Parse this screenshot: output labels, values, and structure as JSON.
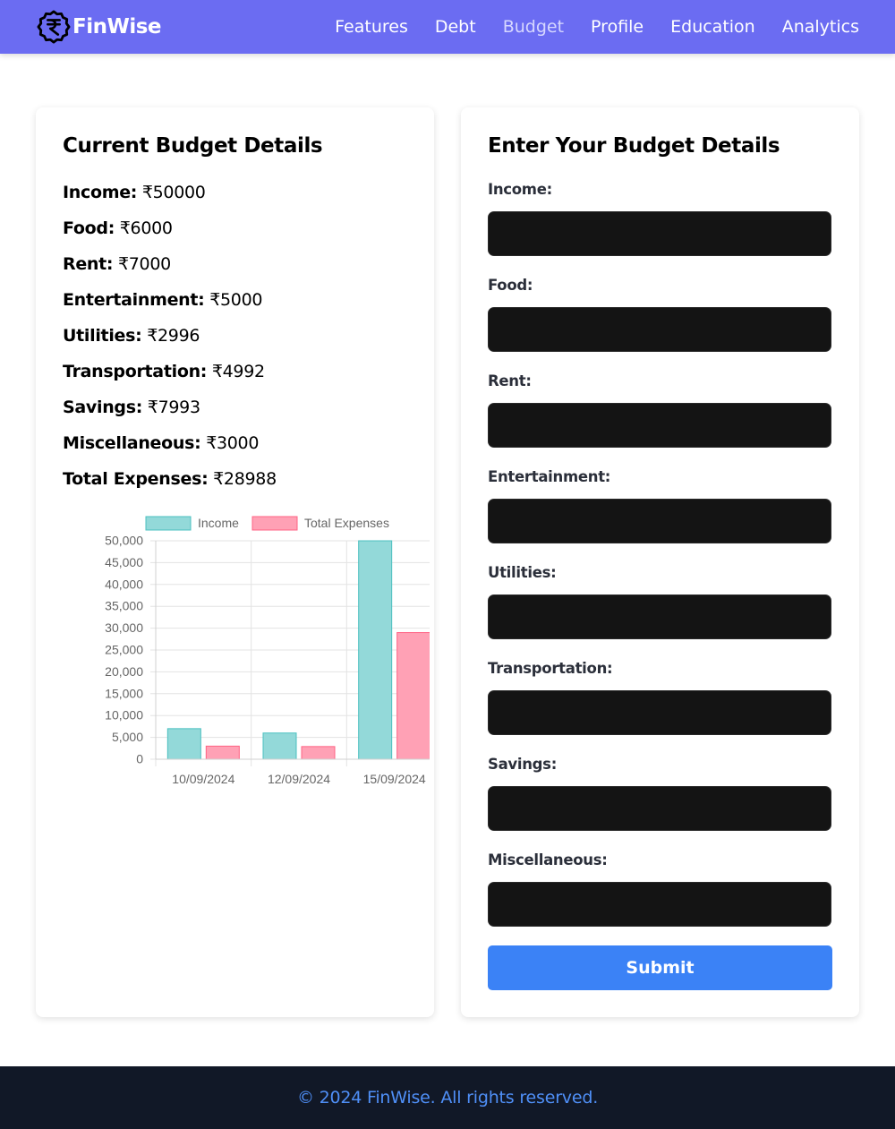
{
  "nav": {
    "brand": "FinWise",
    "links": [
      "Features",
      "Debt",
      "Budget",
      "Profile",
      "Education",
      "Analytics"
    ],
    "active": "Budget"
  },
  "current_budget": {
    "title": "Current Budget Details",
    "items": [
      {
        "label": "Income:",
        "value": "₹50000"
      },
      {
        "label": "Food:",
        "value": "₹6000"
      },
      {
        "label": "Rent:",
        "value": "₹7000"
      },
      {
        "label": "Entertainment:",
        "value": "₹5000"
      },
      {
        "label": "Utilities:",
        "value": "₹2996"
      },
      {
        "label": "Transportation:",
        "value": "₹4992"
      },
      {
        "label": "Savings:",
        "value": "₹7993"
      },
      {
        "label": "Miscellaneous:",
        "value": "₹3000"
      },
      {
        "label": "Total Expenses:",
        "value": "₹28988"
      }
    ]
  },
  "chart_data": {
    "type": "bar",
    "categories": [
      "10/09/2024",
      "12/09/2024",
      "15/09/2024"
    ],
    "series": [
      {
        "name": "Income",
        "values": [
          7000,
          6000,
          50000
        ],
        "fill": "#93d9d9",
        "stroke": "#4bc0c0"
      },
      {
        "name": "Total Expenses",
        "values": [
          3000,
          2900,
          28988
        ],
        "fill": "#ffa1b5",
        "stroke": "#ff6384"
      }
    ],
    "ylim": [
      0,
      50000
    ],
    "y_ticks": [
      "0",
      "5,000",
      "10,000",
      "15,000",
      "20,000",
      "25,000",
      "30,000",
      "35,000",
      "40,000",
      "45,000",
      "50,000"
    ],
    "legend_position": "top",
    "grid": true
  },
  "budget_form": {
    "title": "Enter Your Budget Details",
    "fields": [
      {
        "label": "Income:",
        "value": ""
      },
      {
        "label": "Food:",
        "value": ""
      },
      {
        "label": "Rent:",
        "value": ""
      },
      {
        "label": "Entertainment:",
        "value": ""
      },
      {
        "label": "Utilities:",
        "value": ""
      },
      {
        "label": "Transportation:",
        "value": ""
      },
      {
        "label": "Savings:",
        "value": ""
      },
      {
        "label": "Miscellaneous:",
        "value": ""
      }
    ],
    "submit_label": "Submit"
  },
  "footer": {
    "text": "© 2024 FinWise. All rights reserved."
  },
  "colors": {
    "nav_bg": "#6b6cf2",
    "submit_bg": "#3b82f6",
    "footer_bg": "#111827",
    "footer_text": "#4f8ff7"
  }
}
